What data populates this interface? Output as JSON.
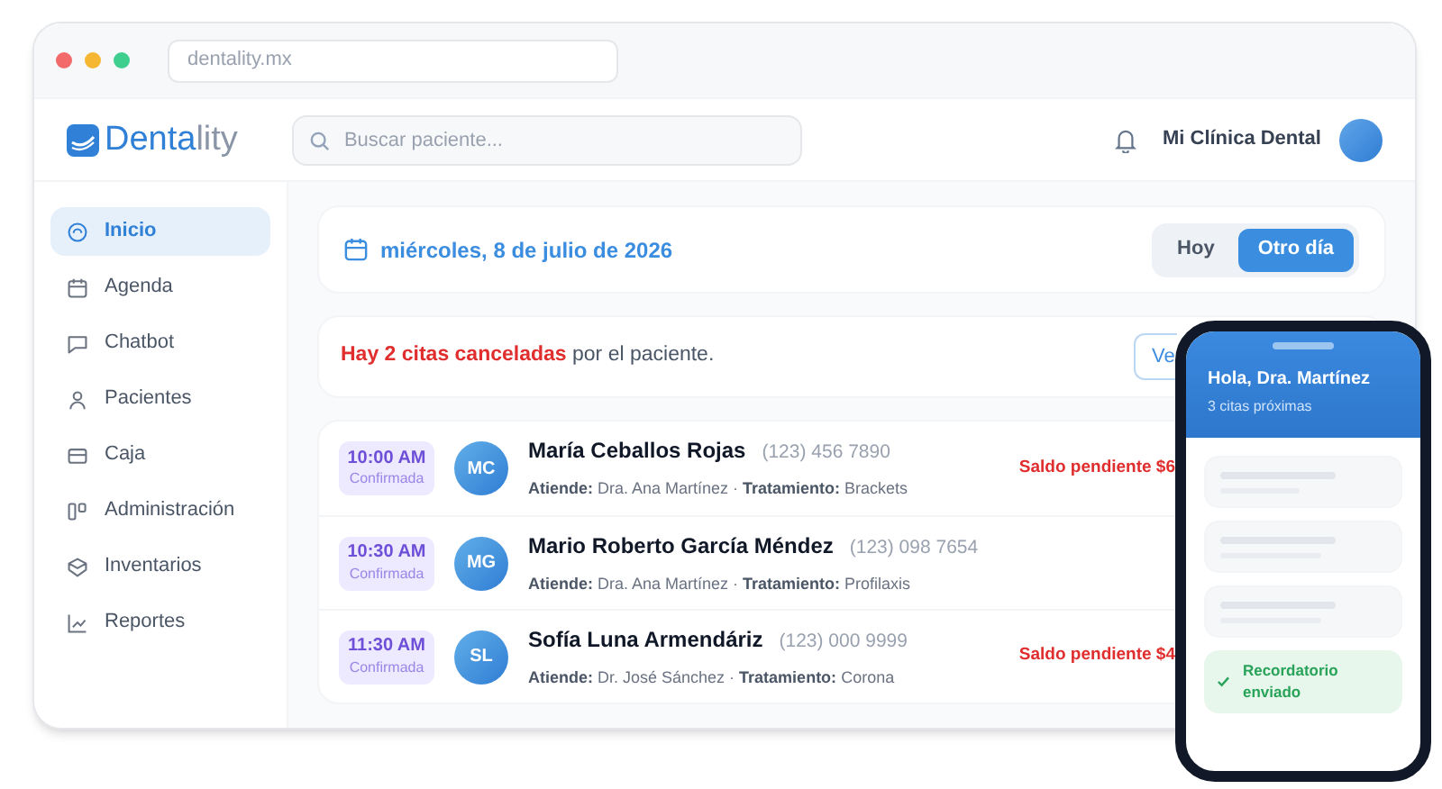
{
  "browser": {
    "url": "dentality.mx"
  },
  "header": {
    "logo": {
      "main": "Denta",
      "accent": "lity"
    },
    "search": {
      "placeholder": "Buscar paciente..."
    },
    "clinic": "Mi Clínica Dental"
  },
  "sidebar": {
    "items": [
      {
        "label": "Inicio",
        "selected": true
      },
      {
        "label": "Agenda",
        "selected": false
      },
      {
        "label": "Chatbot",
        "selected": false
      },
      {
        "label": "Pacientes",
        "selected": false
      },
      {
        "label": "Caja",
        "selected": false
      },
      {
        "label": "Administración",
        "selected": false
      },
      {
        "label": "Inventarios",
        "selected": false
      },
      {
        "label": "Reportes",
        "selected": false
      }
    ]
  },
  "date_bar": {
    "date": "miércoles, 8 de julio de 2026",
    "toggle": [
      {
        "label": "Hoy",
        "selected": false
      },
      {
        "label": "Otro día",
        "selected": true
      }
    ]
  },
  "alert": {
    "message": "**Hay 2 citas canceladas** por el paciente.",
    "button": "Ve"
  },
  "appointments": [
    {
      "time": "10:00 AM",
      "status": "Confirmada",
      "initials": "MC",
      "name": "María Ceballos Rojas",
      "phone": "(123) 456 7890",
      "details": "**Atiende:** Dra. Ana Martínez · **Tratamiento:** Brackets",
      "balance": "Saldo pendiente $6"
    },
    {
      "time": "10:30 AM",
      "status": "Confirmada",
      "initials": "MG",
      "name": "Mario Roberto García Méndez",
      "phone": "(123) 098 7654",
      "details": "**Atiende:** Dra. Ana Martínez · **Tratamiento:** Profilaxis"
    },
    {
      "time": "11:30 AM",
      "status": "Confirmada",
      "initials": "SL",
      "name": "Sofía Luna Armendáriz",
      "phone": "(123) 000 9999",
      "details": "**Atiende:** Dr. José Sánchez · **Tratamiento:** Corona",
      "balance": "Saldo pendiente $4"
    }
  ],
  "phone": {
    "greeting": "Hola, Dra. Martínez",
    "subtitle": "3 citas próximas",
    "notice": "Recordatorio enviado"
  }
}
